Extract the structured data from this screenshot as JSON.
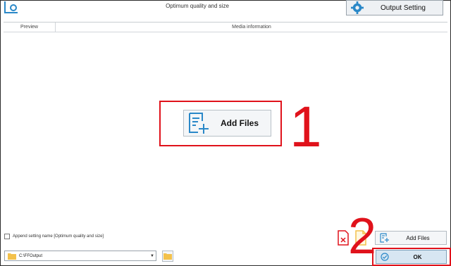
{
  "app": {
    "profile_title": "Optimum quality and size",
    "output_setting_label": "Output Setting"
  },
  "table": {
    "col_preview": "Preview",
    "col_media_info": "Media information"
  },
  "center": {
    "add_files_label": "Add Files",
    "annotation_1": "1"
  },
  "bottom": {
    "append_label": "Append setting name [Optimum quality and size]",
    "output_path": "C:\\FFOutput",
    "add_files_label": "Add Files",
    "ok_label": "OK",
    "annotation_2": "2"
  },
  "colors": {
    "annotation_red": "#e0121b",
    "accent_blue": "#2a88c8"
  }
}
